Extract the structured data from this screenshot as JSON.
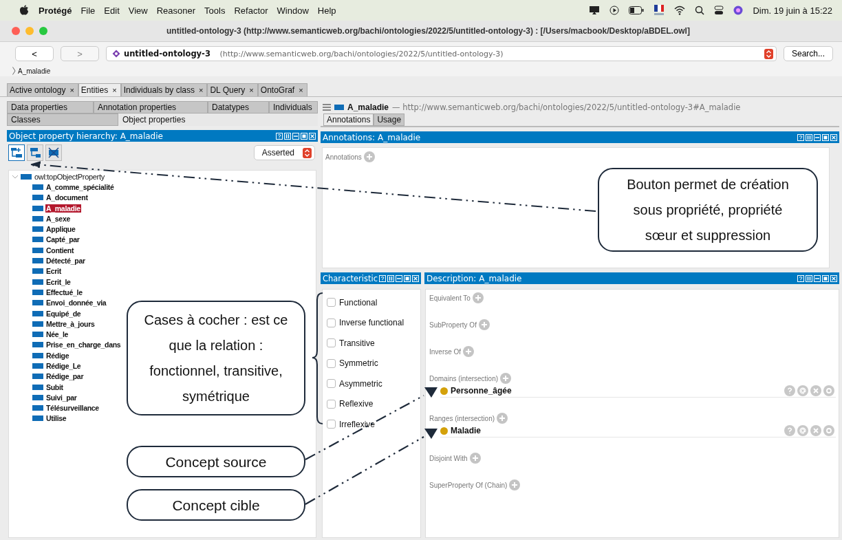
{
  "menu_bar": {
    "app": "Protégé",
    "items": [
      "File",
      "Edit",
      "View",
      "Reasoner",
      "Tools",
      "Refactor",
      "Window",
      "Help"
    ],
    "clock": "Dim. 19 juin à 15:22"
  },
  "window": {
    "title": "untitled-ontology-3 (http://www.semanticweb.org/bachi/ontologies/2022/5/untitled-ontology-3)  : [/Users/macbook/Desktop/aBDEL.owl]"
  },
  "nav": {
    "back": "<",
    "forward": ">",
    "ontology": "untitled-ontology-3",
    "iri": "(http://www.semanticweb.org/bachi/ontologies/2022/5/untitled-ontology-3)",
    "search": "Search..."
  },
  "breadcrumb": "A_maladie",
  "tabs": [
    {
      "label": "Active ontology",
      "close": "×",
      "selected": false
    },
    {
      "label": "Entities",
      "close": "×",
      "selected": true
    },
    {
      "label": "Individuals by class",
      "close": "×",
      "selected": false
    },
    {
      "label": "DL Query",
      "close": "×",
      "selected": false
    },
    {
      "label": "OntoGraf",
      "close": "×",
      "selected": false
    }
  ],
  "entity_tabs": [
    [
      {
        "label": "Data properties",
        "selected": false
      },
      {
        "label": "Annotation properties",
        "selected": false
      },
      {
        "label": "Datatypes",
        "selected": false
      },
      {
        "label": "Individuals",
        "selected": false
      }
    ],
    [
      {
        "label": "Classes",
        "selected": false
      },
      {
        "label": "Object properties",
        "selected": true
      }
    ]
  ],
  "hierarchy": {
    "title": "Object property hierarchy: A_maladie",
    "mode": "Asserted",
    "tree": [
      {
        "label": "owl:topObjectProperty",
        "expanded": true,
        "selected": false,
        "children": [
          {
            "label": "A_comme_spécialité",
            "selected": false
          },
          {
            "label": "A_document",
            "selected": false
          },
          {
            "label": "A_maladie",
            "selected": true
          },
          {
            "label": "A_sexe",
            "selected": false
          },
          {
            "label": "Applique",
            "selected": false
          },
          {
            "label": "Capté_par",
            "selected": false
          },
          {
            "label": "Contient",
            "selected": false
          },
          {
            "label": "Détecté_par",
            "selected": false
          },
          {
            "label": "Ecrit",
            "selected": false
          },
          {
            "label": "Ecrit_le",
            "selected": false
          },
          {
            "label": "Effectué_le",
            "selected": false
          },
          {
            "label": "Envoi_donnée_via",
            "selected": false
          },
          {
            "label": "Equipé_de",
            "selected": false
          },
          {
            "label": "Mettre_à_jours",
            "selected": false
          },
          {
            "label": "Née_le",
            "selected": false
          },
          {
            "label": "Prise_en_charge_dans",
            "selected": false
          },
          {
            "label": "Rédige",
            "selected": false
          },
          {
            "label": "Rédige_Le",
            "selected": false
          },
          {
            "label": "Rédige_par",
            "selected": false
          },
          {
            "label": "Subit",
            "selected": false
          },
          {
            "label": "Suivi_par",
            "selected": false
          },
          {
            "label": "Télésurveillance",
            "selected": false
          },
          {
            "label": "Utilise",
            "selected": false
          }
        ]
      }
    ]
  },
  "entity": {
    "name": "A_maladie",
    "iri": "— http://www.semanticweb.org/bachi/ontologies/2022/5/untitled-ontology-3#A_maladie"
  },
  "detail_tabs": [
    {
      "label": "Annotations",
      "selected": true
    },
    {
      "label": "Usage",
      "selected": false
    }
  ],
  "annotations": {
    "title": "Annotations: A_maladie",
    "label": "Annotations"
  },
  "characteristics": {
    "title": "Characteristic",
    "items": [
      {
        "label": "Functional",
        "checked": false
      },
      {
        "label": "Inverse functional",
        "checked": false
      },
      {
        "label": "Transitive",
        "checked": false
      },
      {
        "label": "Symmetric",
        "checked": false
      },
      {
        "label": "Asymmetric",
        "checked": false
      },
      {
        "label": "Reflexive",
        "checked": false
      },
      {
        "label": "Irreflexive",
        "checked": false
      }
    ]
  },
  "description": {
    "title": "Description: A_maladie",
    "sections": [
      {
        "label": "Equivalent To"
      },
      {
        "label": "SubProperty Of"
      },
      {
        "label": "Inverse Of"
      },
      {
        "label": "Domains (intersection)",
        "entries": [
          "Personne_âgée"
        ]
      },
      {
        "label": "Ranges (intersection)",
        "entries": [
          "Maladie"
        ]
      },
      {
        "label": "Disjoint With"
      },
      {
        "label": "SuperProperty Of (Chain)"
      }
    ]
  },
  "callouts": [
    "Bouton permet de création sous propriété, propriété sœur et suppression",
    "Cases à cocher : est ce que la relation : fonctionnel, transitive, symétrique",
    "Concept source",
    "Concept cible"
  ]
}
